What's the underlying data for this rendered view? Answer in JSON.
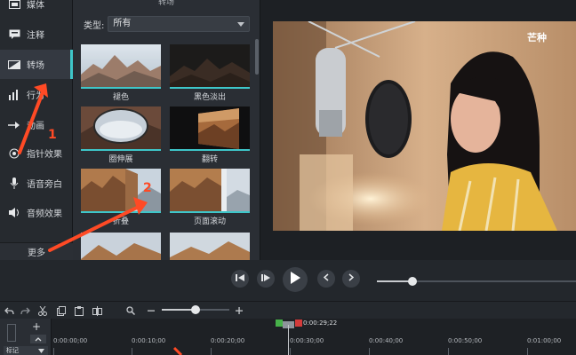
{
  "sidebar": {
    "items": [
      {
        "label": "媒体",
        "icon": "media-icon"
      },
      {
        "label": "注释",
        "icon": "annotation-icon"
      },
      {
        "label": "转场",
        "icon": "transition-icon"
      },
      {
        "label": "行为",
        "icon": "behavior-icon"
      },
      {
        "label": "动画",
        "icon": "animation-icon"
      },
      {
        "label": "指针效果",
        "icon": "cursor-effect-icon"
      },
      {
        "label": "语音旁白",
        "icon": "microphone-icon"
      },
      {
        "label": "音频效果",
        "icon": "audio-effect-icon"
      }
    ],
    "active_index": 2,
    "more_label": "更多"
  },
  "panel": {
    "title": "转场",
    "type_label": "类型:",
    "type_value": "所有",
    "tiles": [
      {
        "label": "褪色"
      },
      {
        "label": "黑色淡出"
      },
      {
        "label": "圈伸展"
      },
      {
        "label": "翻转"
      },
      {
        "label": "折叠"
      },
      {
        "label": "页面滚动"
      }
    ]
  },
  "preview": {
    "watermark": "芒种"
  },
  "timeline": {
    "playhead_time": "0:00:29;22",
    "marker_label": "标记",
    "ticks": [
      "0:00:00;00",
      "0:00:10;00",
      "0:00:20;00",
      "0:00:30;00",
      "0:00:40;00",
      "0:00:50;00",
      "0:01:00;00"
    ]
  },
  "annotations": {
    "one": "1",
    "two": "2"
  },
  "colors": {
    "accent": "#3ec6c9",
    "annotation": "#ff4a25"
  }
}
